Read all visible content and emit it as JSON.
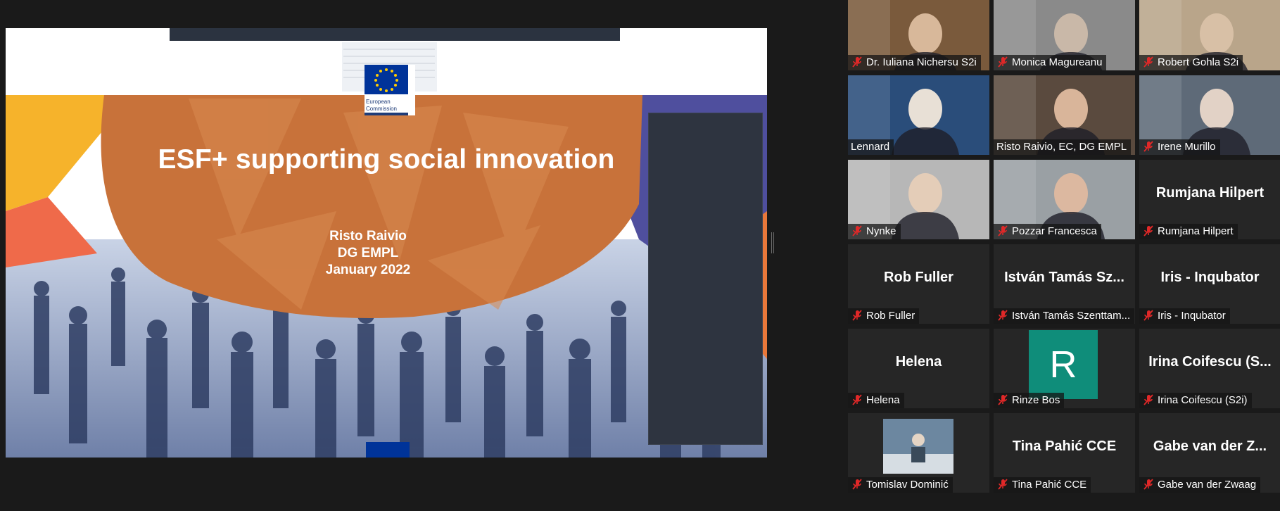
{
  "slide": {
    "title": "ESF+ supporting social innovation",
    "presenter": "Risto Raivio",
    "department": "DG EMPL",
    "date": "January 2022",
    "logo_text_line1": "European",
    "logo_text_line2": "Commission"
  },
  "participants": [
    {
      "name": "Dr. Iuliana Nichersu S2i",
      "muted": true,
      "video": true,
      "active": false
    },
    {
      "name": "Monica Magureanu",
      "muted": true,
      "video": true,
      "active": false
    },
    {
      "name": "Robert Gohla S2i",
      "muted": true,
      "video": true,
      "active": false
    },
    {
      "name": "Lennard",
      "muted": false,
      "video": true,
      "active": false
    },
    {
      "name": "Risto Raivio, EC, DG EMPL",
      "muted": false,
      "video": true,
      "active": true
    },
    {
      "name": "Irene Murillo",
      "muted": true,
      "video": true,
      "active": false
    },
    {
      "name": "Nynke",
      "muted": true,
      "video": true,
      "active": false
    },
    {
      "name": "Pozzar Francesca",
      "muted": true,
      "video": true,
      "active": false
    },
    {
      "name": "Rumjana Hilpert",
      "display": "Rumjana Hilpert",
      "muted": true,
      "video": false,
      "active": false
    },
    {
      "name": "Rob Fuller",
      "display": "Rob Fuller",
      "muted": true,
      "video": false,
      "active": false
    },
    {
      "name": "István Tamás Szenttam...",
      "display": "István Tamás Sz...",
      "muted": true,
      "video": false,
      "active": false
    },
    {
      "name": "Iris - Inqubator",
      "display": "Iris - Inqubator",
      "muted": true,
      "video": false,
      "active": false
    },
    {
      "name": "Helena",
      "display": "Helena",
      "muted": true,
      "video": false,
      "active": false
    },
    {
      "name": "Rinze Bos",
      "avatar_letter": "R",
      "muted": true,
      "video": false,
      "active": false
    },
    {
      "name": "Irina Coifescu (S2i)",
      "display": "Irina Coifescu (S...",
      "muted": true,
      "video": false,
      "active": false
    },
    {
      "name": "Tomislav Dominić",
      "muted": true,
      "video": true,
      "active": false
    },
    {
      "name": "Tina Pahić CCE",
      "display": "Tina Pahić CCE",
      "muted": true,
      "video": false,
      "active": false
    },
    {
      "name": "Gabe van der Zwaag",
      "display": "Gabe van der Z...",
      "muted": true,
      "video": false,
      "active": false
    }
  ],
  "colors": {
    "active_border": "#c8e06a",
    "avatar_bg": "#0f8d7a",
    "muted_icon": "#e02828",
    "slide_orange": "#c8723a"
  }
}
